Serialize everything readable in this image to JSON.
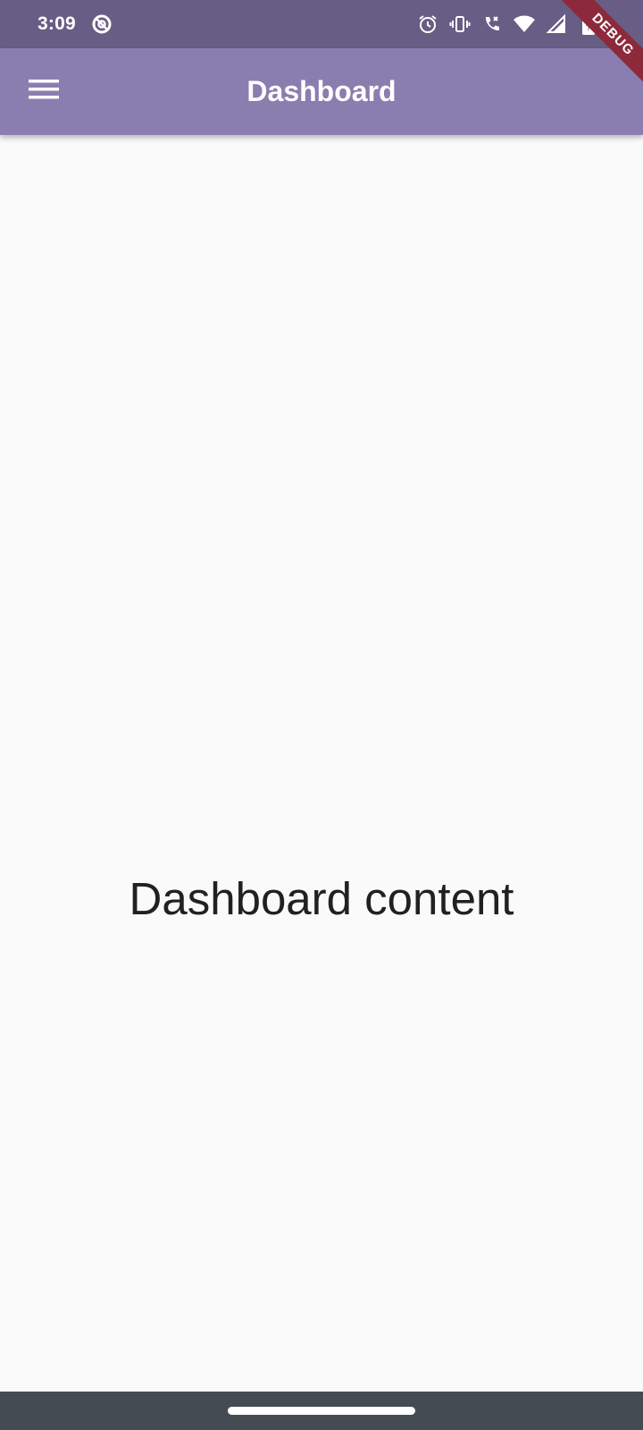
{
  "colors": {
    "status_bar_bg": "#685d85",
    "app_bar_bg": "#8a7db0",
    "page_bg": "#fafafa",
    "nav_bar_bg": "#454b52",
    "debug_banner_bg": "#8c2a3b"
  },
  "status_bar": {
    "time": "3:09",
    "left_icon": "sync-disabled-icon",
    "right_icons": [
      "alarm-icon",
      "vibrate-icon",
      "wifi-calling-icon",
      "wifi-icon",
      "cell-signal-icon",
      "battery-icon"
    ]
  },
  "app_bar": {
    "title": "Dashboard",
    "menu_icon": "hamburger-menu-icon"
  },
  "main": {
    "content_text": "Dashboard content"
  },
  "debug_banner": {
    "label": "DEBUG"
  }
}
